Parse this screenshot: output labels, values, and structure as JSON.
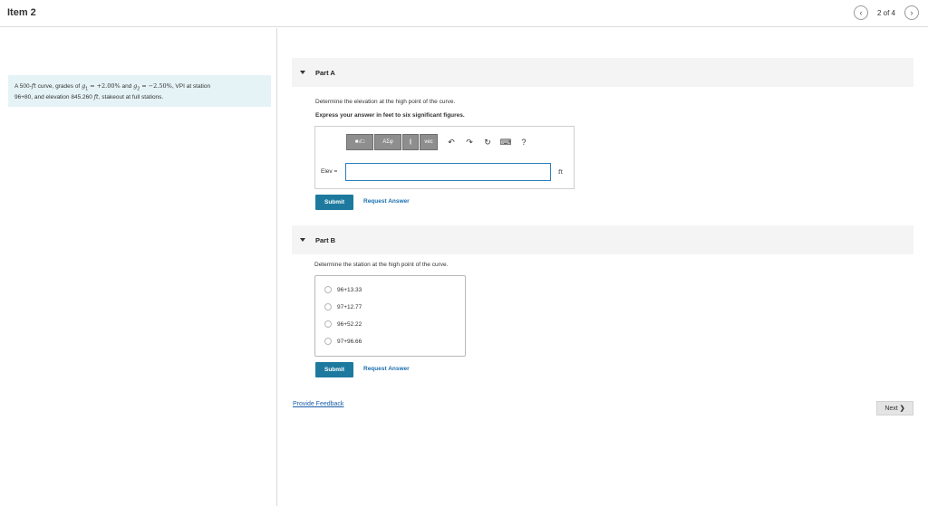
{
  "header": {
    "title": "Item 2",
    "pager_text": "2 of 4",
    "prev_icon": "chevron-left-icon",
    "next_icon": "chevron-right-icon"
  },
  "problem": {
    "text_1": "A 500-",
    "unit_ft": "ft",
    "text_2": " curve, grades of ",
    "g1": "g",
    "g1_sub": "1",
    "g1_val": " = +2.00%",
    "text_3": " and ",
    "g2": "g",
    "g2_sub": "2",
    "g2_val": " = −2.50%",
    "text_4": ", VPI at station",
    "text_5": "96+80, and elevation 845.260 ",
    "text_6": ", stakeout at full stations."
  },
  "part_a": {
    "label": "Part A",
    "question": "Determine the elevation at the high point of the curve.",
    "instruction": "Express your answer in feet to six significant figures.",
    "toolbar": {
      "template_btn": "■√□",
      "greek_btn": "ΑΣφ",
      "matrix_btn": "||",
      "vec_btn": "vec",
      "undo_icon": "↶",
      "redo_icon": "↷",
      "reset_icon": "↻",
      "keyboard_icon": "⌨",
      "help_icon": "?"
    },
    "input_label": "Elev =",
    "input_value": "",
    "unit": "ft",
    "submit_label": "Submit",
    "request_label": "Request Answer"
  },
  "part_b": {
    "label": "Part B",
    "question": "Determine the station at the high point of the curve.",
    "options": [
      "96+13.33",
      "97+12.77",
      "96+52.22",
      "97+96.66"
    ],
    "submit_label": "Submit",
    "request_label": "Request Answer"
  },
  "footer": {
    "feedback_link": "Provide Feedback",
    "next_label": "Next",
    "next_icon": "❯"
  },
  "colors": {
    "accent": "#1d7a9e",
    "link": "#1a6fb0",
    "problem_bg": "#e6f3f6",
    "header_bg": "#f4f4f4"
  }
}
